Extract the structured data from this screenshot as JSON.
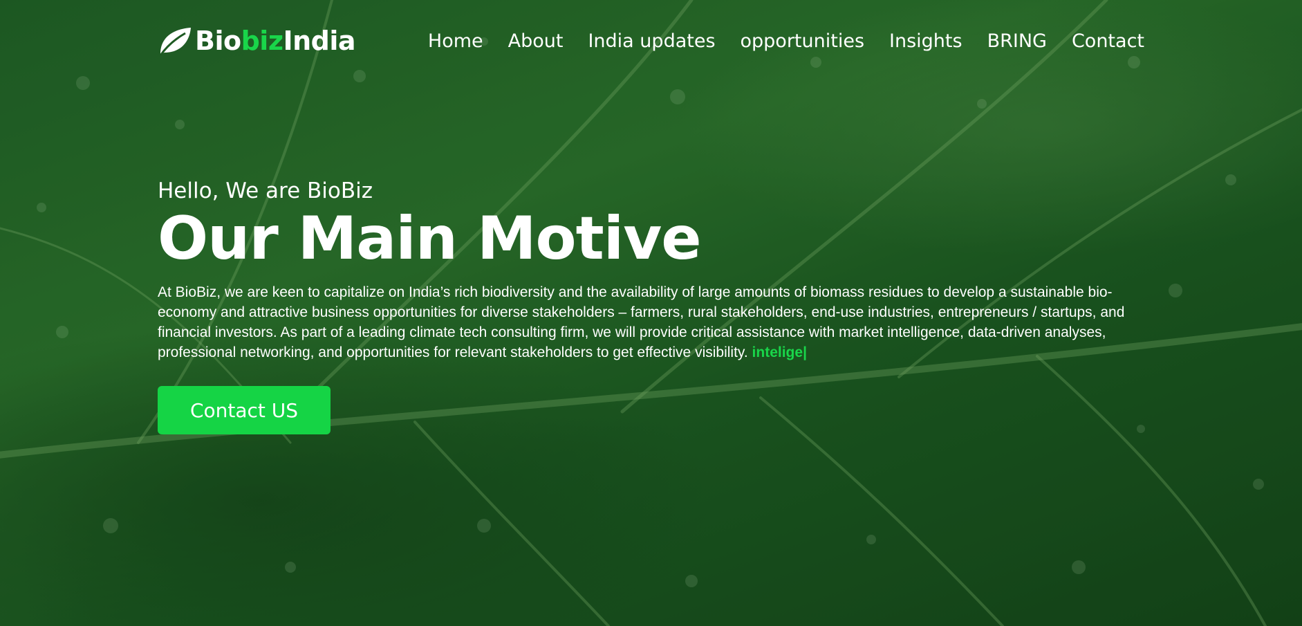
{
  "logo": {
    "part1": "Bio",
    "part2": "biz",
    "part3": "India",
    "icon": "leaf-icon",
    "accent_color": "#19d64a"
  },
  "nav": {
    "items": [
      {
        "label": "Home"
      },
      {
        "label": "About"
      },
      {
        "label": "India updates"
      },
      {
        "label": "opportunities"
      },
      {
        "label": "Insights"
      },
      {
        "label": "BRING"
      },
      {
        "label": "Contact"
      }
    ]
  },
  "hero": {
    "greeting": "Hello, We are BioBiz",
    "headline": "Our Main Motive",
    "description": "At BioBiz, we are keen to capitalize on India’s rich biodiversity and the availability of large amounts of biomass residues to develop a sustainable bio-economy and attractive business opportunities for diverse stakeholders – farmers, rural stakeholders, end-use industries, entrepreneurs / startups, and financial investors. As part of a leading climate tech consulting firm, we will provide critical assistance with market intelligence, data-driven analyses, professional networking, and opportunities for relevant stakeholders to get effective visibility.",
    "typed_text": "intelige",
    "cursor": "|",
    "cta_label": "Contact US",
    "cta_color": "#15d445"
  }
}
